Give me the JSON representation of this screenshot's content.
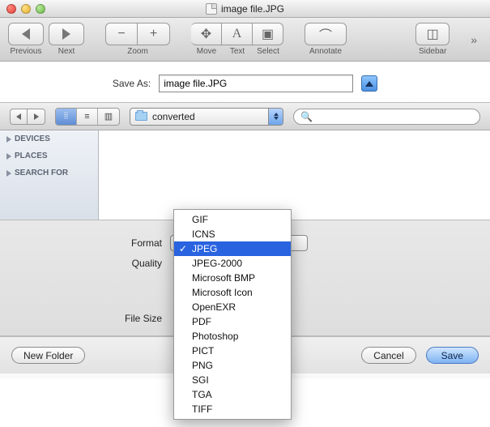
{
  "window": {
    "title": "image file.JPG"
  },
  "toolbar": {
    "previous": "Previous",
    "next": "Next",
    "zoom": "Zoom",
    "move": "Move",
    "text": "Text",
    "select": "Select",
    "annotate": "Annotate",
    "sidebar": "Sidebar"
  },
  "save": {
    "label": "Save As:",
    "value": "image file.JPG"
  },
  "browser": {
    "folder": "converted",
    "search_placeholder": "",
    "sidebar": {
      "devices": "DEVICES",
      "places": "PLACES",
      "search_for": "SEARCH FOR"
    }
  },
  "options": {
    "format_label": "Format",
    "quality_label": "Quality",
    "filesize_label": "File Size"
  },
  "formats": {
    "items": [
      "GIF",
      "ICNS",
      "JPEG",
      "JPEG-2000",
      "Microsoft BMP",
      "Microsoft Icon",
      "OpenEXR",
      "PDF",
      "Photoshop",
      "PICT",
      "PNG",
      "SGI",
      "TGA",
      "TIFF"
    ],
    "selected": "JPEG"
  },
  "footer": {
    "new_folder": "New Folder",
    "cancel": "Cancel",
    "save": "Save"
  }
}
